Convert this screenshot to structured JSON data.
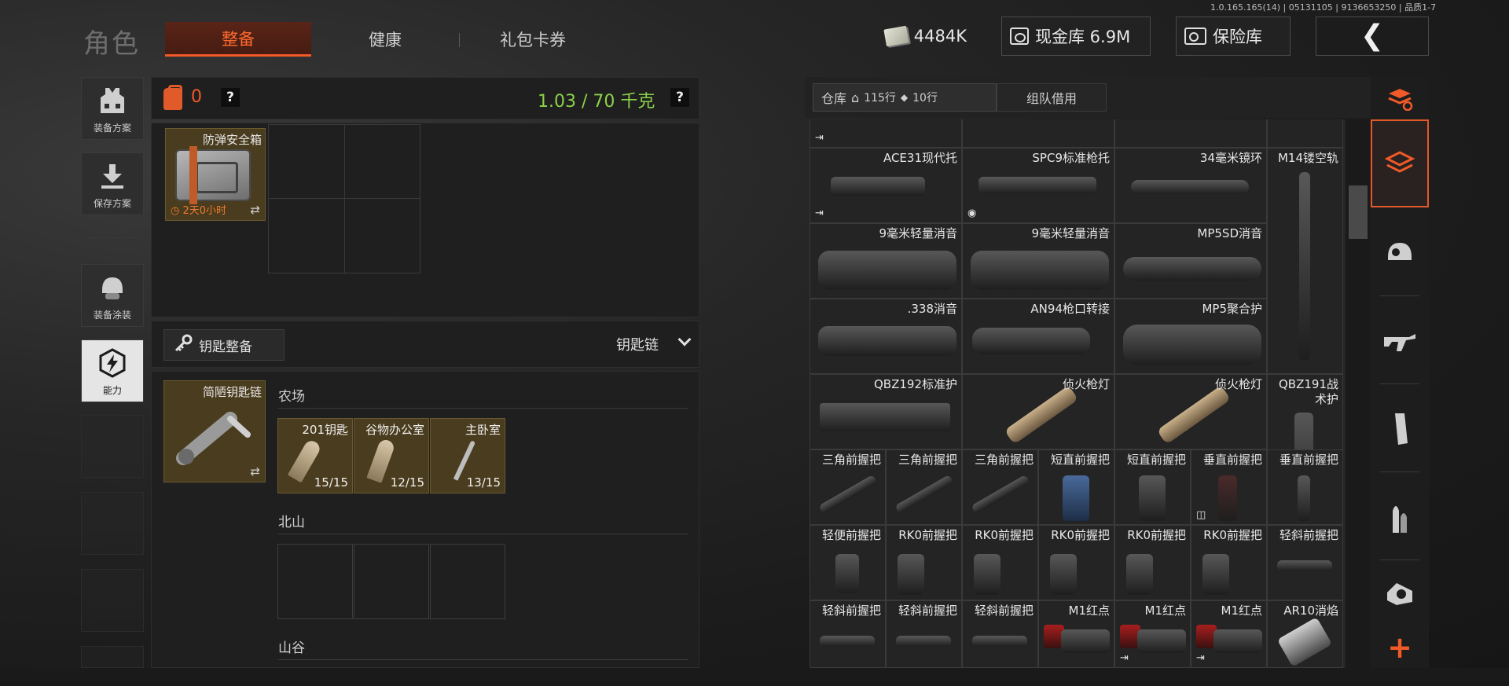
{
  "version": "1.0.165.165(14) | 05131105 | 9136653250 | 品质1-7",
  "header": {
    "title": "角色",
    "tabs": [
      "整备",
      "健康",
      "礼包卡券"
    ],
    "currency": "4484K",
    "cash_vault": "现金库 6.9M",
    "safe_vault": "保险库"
  },
  "sidebar": {
    "items": [
      {
        "label": "装备方案",
        "icon": "vest-icon"
      },
      {
        "label": "保存方案",
        "icon": "download-icon"
      },
      {
        "label": "装备涂装",
        "icon": "helmet-icon"
      },
      {
        "label": "能力",
        "icon": "lightning-icon"
      }
    ]
  },
  "loadout": {
    "armor_value": "0",
    "weight": "1.03 / 70 千克",
    "help": "?",
    "safe_case": {
      "name": "防弹安全箱",
      "timer": "2天0小时",
      "swap": "⇄"
    }
  },
  "keys": {
    "button_label": "钥匙整备",
    "keychain_label": "钥匙链",
    "keychain": {
      "name": "简陋钥匙链",
      "swap": "⇄"
    },
    "areas": [
      {
        "name": "农场",
        "keys": [
          {
            "name": "201钥匙",
            "count": "15/15"
          },
          {
            "name": "谷物办公室",
            "count": "12/15"
          },
          {
            "name": "主卧室",
            "count": "13/15"
          }
        ]
      },
      {
        "name": "北山",
        "keys": []
      },
      {
        "name": "山谷",
        "keys": []
      }
    ]
  },
  "warehouse": {
    "tab_label": "仓库",
    "rows_label": "115行",
    "items_label": "10行",
    "team_tab": "组队借用",
    "rows": [
      [
        "ACE31现代托",
        "SPC9标准枪托",
        "34毫米镜环",
        "M14镂空轨"
      ],
      [
        "9毫米轻量消音",
        "9毫米轻量消音",
        "MP5SD消音"
      ],
      [
        ".338消音",
        "AN94枪口转接",
        "MP5聚合护",
        "QBZ191战术护"
      ],
      [
        "QBZ192标准护",
        "侦火枪灯",
        "侦火枪灯"
      ],
      [
        "三角前握把",
        "三角前握把",
        "三角前握把",
        "短直前握把",
        "短直前握把",
        "垂直前握把",
        "垂直前握把"
      ],
      [
        "轻便前握把",
        "RK0前握把",
        "RK0前握把",
        "RK0前握把",
        "RK0前握把",
        "RK0前握把",
        "轻斜前握把"
      ],
      [
        "轻斜前握把",
        "轻斜前握把",
        "轻斜前握把",
        "M1红点",
        "M1红点",
        "M1红点",
        "AR10消焰"
      ]
    ]
  },
  "colors": {
    "accent": "#f05a28",
    "weight_green": "#8bd24a",
    "item_gold": "#4a3c1e"
  }
}
